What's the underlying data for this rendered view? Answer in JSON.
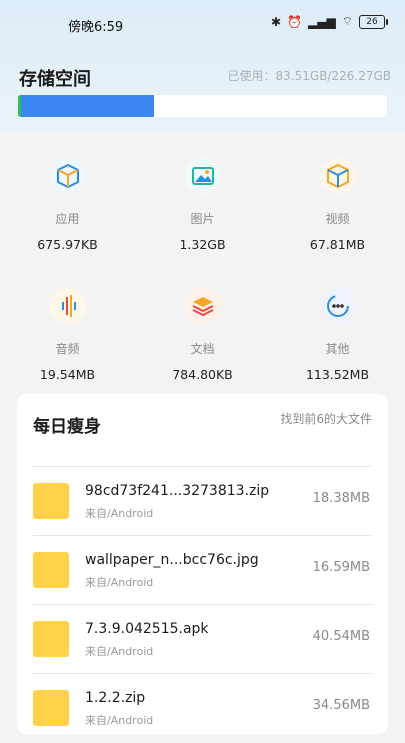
{
  "status_bar": {
    "time": "傍晚6:59",
    "battery": "26"
  },
  "storage": {
    "title": "存储空间",
    "used_text": "已使用：83.51GB/226.27GB",
    "used_fraction": 0.369,
    "fill_color": "#3b86f0"
  },
  "categories": [
    {
      "label": "应用",
      "size": "675.97KB",
      "icon": "app-box-icon"
    },
    {
      "label": "图片",
      "size": "1.32GB",
      "icon": "image-icon"
    },
    {
      "label": "视频",
      "size": "67.81MB",
      "icon": "video-box-icon"
    },
    {
      "label": "音频",
      "size": "19.54MB",
      "icon": "audio-icon"
    },
    {
      "label": "文档",
      "size": "784.80KB",
      "icon": "document-stack-icon"
    },
    {
      "label": "其他",
      "size": "113.52MB",
      "icon": "more-icon"
    }
  ],
  "cleanup": {
    "title": "每日瘦身",
    "hint": "找到前6的大文件",
    "files": [
      {
        "name": "98cd73f241...3273813.zip",
        "source": "来自/Android",
        "size": "18.38MB"
      },
      {
        "name": "wallpaper_n...bcc76c.jpg",
        "source": "来自/Android",
        "size": "16.59MB"
      },
      {
        "name": "7.3.9.042515.apk",
        "source": "来自/Android",
        "size": "40.54MB"
      },
      {
        "name": "1.2.2.zip",
        "source": "来自/Android",
        "size": "34.56MB"
      }
    ]
  }
}
